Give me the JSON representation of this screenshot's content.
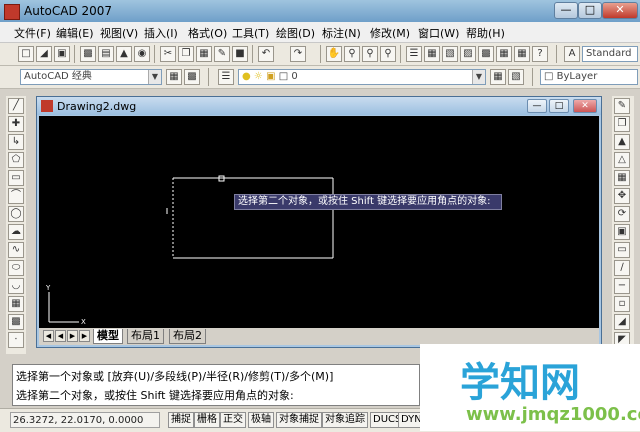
{
  "window": {
    "title": "AutoCAD 2007"
  },
  "menu": [
    "文件(F)",
    "编辑(E)",
    "视图(V)",
    "插入(I)",
    "格式(O)",
    "工具(T)",
    "绘图(D)",
    "标注(N)",
    "修改(M)",
    "窗口(W)",
    "帮助(H)"
  ],
  "toolbar": {
    "text_style": "Standard",
    "workspace": "AutoCAD 经典",
    "layer": "0",
    "color": "ByLayer"
  },
  "drawing": {
    "title": "Drawing2.dwg",
    "tooltip": "选择第二个对象，或按住 Shift 键选择要应用角点的对象:",
    "axis_y": "Y",
    "axis_x": "X",
    "tabs": [
      "模型",
      "布局1",
      "布局2"
    ]
  },
  "command": {
    "line1": "选择第一个对象或 [放弃(U)/多段线(P)/半径(R)/修剪(T)/多个(M)]",
    "line2": "选择第二个对象，或按住 Shift 键选择要应用角点的对象:"
  },
  "status": {
    "coords": "26.3272, 22.0170, 0.0000",
    "buttons": [
      "捕捉",
      "栅格",
      "正交",
      "极轴",
      "对象捕捉",
      "对象追踪",
      "DUCS",
      "DYN"
    ]
  },
  "watermark": {
    "title": "学知网",
    "url": "www.jmqz1000.com"
  }
}
